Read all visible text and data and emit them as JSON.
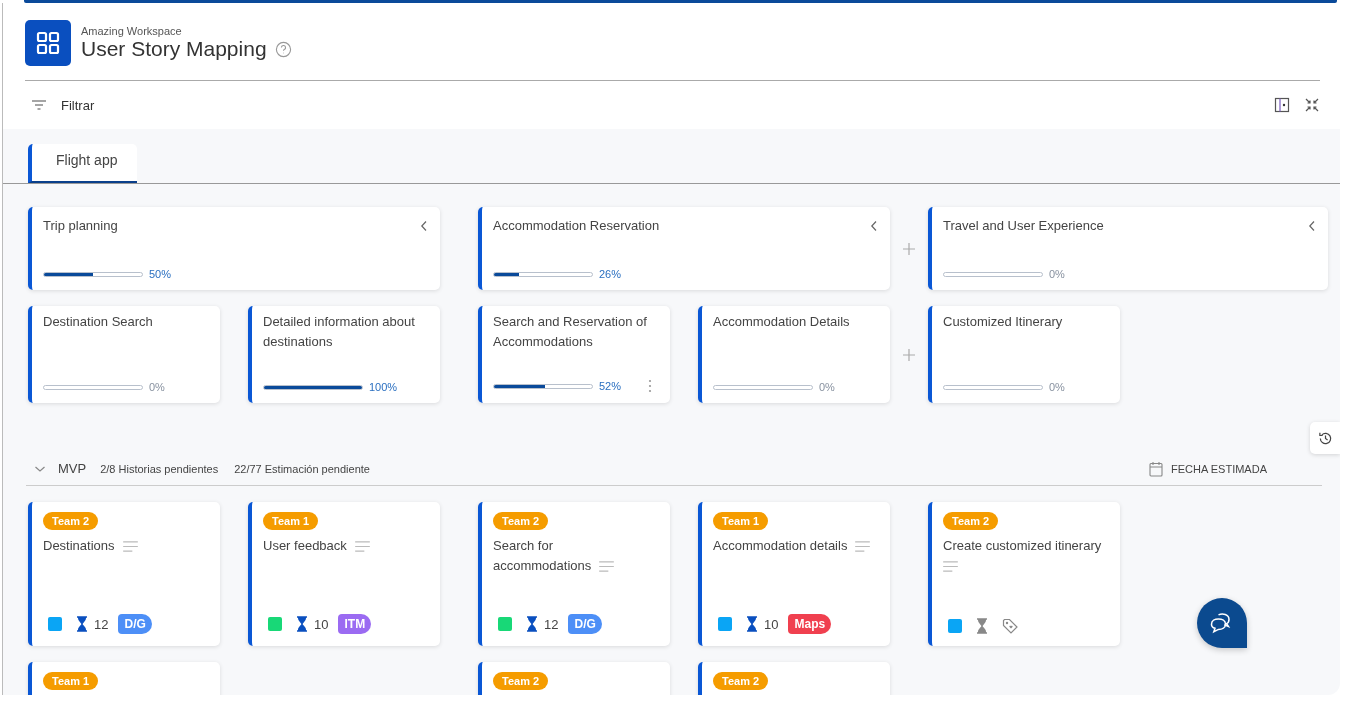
{
  "workspace": "Amazing Workspace",
  "title": "User Story Mapping",
  "filter": "Filtrar",
  "tabs": [
    {
      "label": "Flight app",
      "selected": true
    }
  ],
  "activities": [
    {
      "title": "Trip planning",
      "level": 0.5,
      "percent": "50%"
    },
    {
      "title": "Accommodation Reservation",
      "level": 0.26,
      "percent": "26%"
    },
    {
      "title": "Travel and User Experience",
      "level": 0,
      "percent": "0%"
    }
  ],
  "tasks": [
    {
      "title": "Destination Search",
      "level": 0,
      "percent": "0%",
      "menu": false
    },
    {
      "title": "Detailed information about destinations",
      "level": 1,
      "percent": "100%",
      "menu": false
    },
    {
      "title": "Search and Reservation of Accommodations",
      "level": 0.52,
      "percent": "52%",
      "menu": true
    },
    {
      "title": "Accommodation Details",
      "level": 0,
      "percent": "0%",
      "menu": false
    },
    {
      "title": "Customized Itinerary",
      "level": 0,
      "percent": "0%",
      "menu": false
    }
  ],
  "release": {
    "name": "MVP",
    "expanded": true,
    "stories_pending": "2/8 Historias pendientes",
    "estimate_pending": "22/77 Estimación pendiente",
    "date_label": "FECHA ESTIMADA"
  },
  "story_rows": [
    [
      {
        "team": "Team 2",
        "title": "Destinations",
        "color": "#0aa5f5",
        "estimate": "12",
        "tag": {
          "label": "D/G",
          "color": "#4d8ff7"
        }
      },
      {
        "team": "Team 1",
        "title": "User feedback",
        "color": "#18d877",
        "estimate": "10",
        "tag": {
          "label": "ITM",
          "color": "#9b6bf2"
        }
      },
      {
        "team": "Team 2",
        "title": "Search for accommodations",
        "color": "#18d877",
        "estimate": "12",
        "tag": {
          "label": "D/G",
          "color": "#4d8ff7"
        }
      },
      {
        "team": "Team 1",
        "title": "Accommodation details",
        "color": "#0aa5f5",
        "estimate": "10",
        "tag": {
          "label": "Maps",
          "color": "#f0404f"
        }
      },
      {
        "team": "Team 2",
        "title": "Create customized itinerary",
        "color": "#0aa5f5"
      }
    ],
    [
      {
        "team": "Team 1"
      },
      null,
      {
        "team": "Team 2"
      },
      {
        "team": "Team 2"
      },
      null
    ]
  ]
}
